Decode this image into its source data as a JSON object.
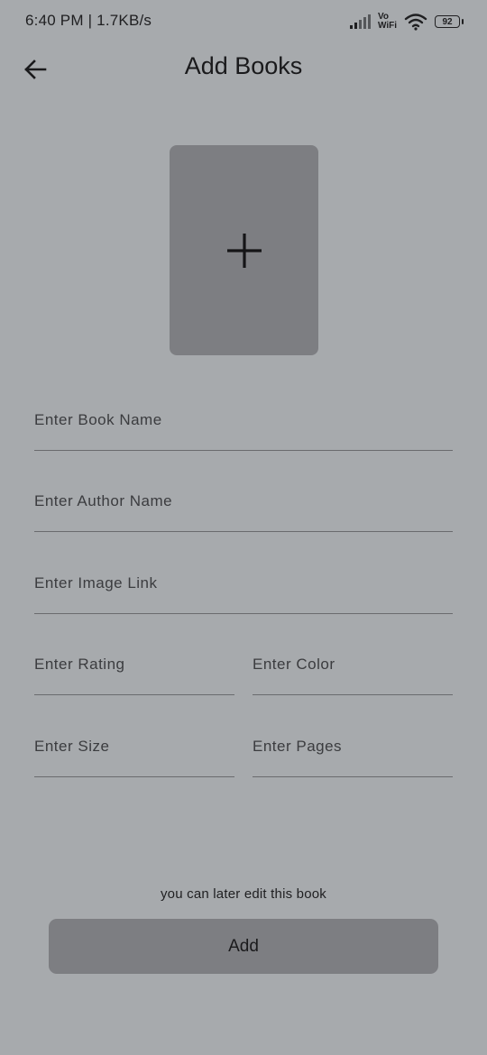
{
  "status_bar": {
    "time_speed": "6:40 PM | 1.7KB/s",
    "vo_label": "Vo",
    "wifi_label": "WiFi",
    "battery": "92"
  },
  "header": {
    "title": "Add Books",
    "back_icon": "arrow-left-icon"
  },
  "image_picker": {
    "icon": "plus-icon"
  },
  "form": {
    "book_name_placeholder": "Enter Book Name",
    "author_name_placeholder": "Enter Author Name",
    "image_link_placeholder": "Enter Image Link",
    "rating_placeholder": "Enter Rating",
    "color_placeholder": "Enter Color",
    "size_placeholder": "Enter Size",
    "pages_placeholder": "Enter Pages"
  },
  "footer": {
    "hint": "you can later edit this book",
    "add_label": "Add"
  },
  "colors": {
    "background": "#a7aaad",
    "picker_fill": "#7d7e82",
    "button_fill": "#7d7e82",
    "underline": "#6a6b6e"
  }
}
